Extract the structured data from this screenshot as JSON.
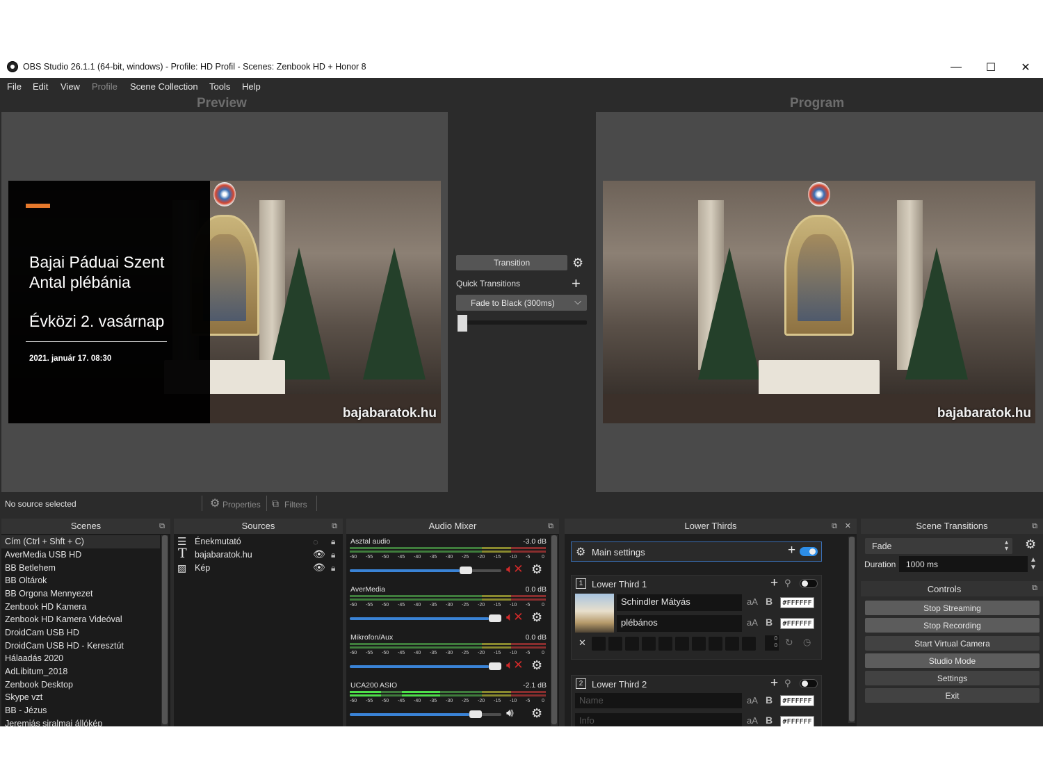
{
  "window": {
    "title": "OBS Studio 26.1.1 (64-bit, windows) - Profile: HD Profil - Scenes: Zenbook HD + Honor 8",
    "minimize": "—",
    "maximize": "☐",
    "close": "✕"
  },
  "menu": {
    "items": [
      "File",
      "Edit",
      "View",
      "Profile",
      "Scene Collection",
      "Tools",
      "Help"
    ],
    "disabled": [
      "Profile"
    ]
  },
  "preview": {
    "label": "Preview",
    "title_line1": "Bajai Páduai Szent",
    "title_line2": "Antal plébánia",
    "title_line3": "Évközi 2. vasárnap",
    "datetime": "2021. január 17. 08:30",
    "watermark": "bajabaratok.hu"
  },
  "program": {
    "label": "Program",
    "watermark": "bajabaratok.hu"
  },
  "transition_panel": {
    "transition_button": "Transition",
    "quick_transitions_label": "Quick Transitions",
    "selected_quick_transition": "Fade to Black (300ms)",
    "tbar_position": 0
  },
  "status": {
    "no_source": "No source selected",
    "properties": "Properties",
    "filters": "Filters"
  },
  "scenes": {
    "title": "Scenes",
    "items": [
      "Cím (Ctrl + Shft + C)",
      "AverMedia USB HD",
      "BB Betlehem",
      "BB Oltárok",
      "BB Orgona Mennyezet",
      "Zenbook HD Kamera",
      "Zenbook HD Kamera Videóval",
      "DroidCam USB HD",
      "DroidCam USB HD - Keresztút",
      "Hálaadás 2020",
      "AdLibitum_2018",
      "Zenbook Desktop",
      "Skype vzt",
      "BB - Jézus",
      "Jeremiás siralmai állókép"
    ]
  },
  "sources": {
    "title": "Sources",
    "items": [
      {
        "name": "Énekmutató",
        "icon": "list-icon",
        "visible": false
      },
      {
        "name": "bajabaratok.hu",
        "icon": "text-icon",
        "visible": true
      },
      {
        "name": "Kép",
        "icon": "image-icon",
        "visible": true
      }
    ]
  },
  "audio_mixer": {
    "title": "Audio Mixer",
    "tick_labels": [
      "-60",
      "-55",
      "-50",
      "-45",
      "-40",
      "-35",
      "-30",
      "-25",
      "-20",
      "-15",
      "-10",
      "-5",
      "0"
    ],
    "channels": [
      {
        "name": "Asztal audio",
        "db": "-3.0 dB",
        "volume": 0.79,
        "muted": true
      },
      {
        "name": "AverMedia",
        "db": "0.0 dB",
        "volume": 1.0,
        "muted": true
      },
      {
        "name": "Mikrofon/Aux",
        "db": "0.0 dB",
        "volume": 1.0,
        "muted": true
      },
      {
        "name": "UCA200 ASIO",
        "db": "-2.1 dB",
        "volume": 0.86,
        "muted": false
      }
    ]
  },
  "lower_thirds": {
    "title": "Lower Thirds",
    "main_settings": "Main settings",
    "card1": {
      "label": "Lower Third 1",
      "name_value": "Schindler Mátyás",
      "info_value": "plébános",
      "name_color": "#FFFFFF",
      "info_color": "#FFFFFF",
      "font_size_glyph": "aA",
      "bold_glyph": "B"
    },
    "card2": {
      "label": "Lower Third 2",
      "name_placeholder": "Name",
      "info_placeholder": "Info",
      "name_color": "#FFFFFF",
      "info_color": "#FFFFFF",
      "font_size_glyph": "aA",
      "bold_glyph": "B"
    },
    "counter_up": "0",
    "counter_down": "0"
  },
  "scene_transitions": {
    "title": "Scene Transitions",
    "selected": "Fade",
    "duration_label": "Duration",
    "duration_value": "1000 ms"
  },
  "controls": {
    "title": "Controls",
    "buttons": [
      "Stop Streaming",
      "Stop Recording",
      "Start Virtual Camera",
      "Studio Mode",
      "Settings",
      "Exit"
    ]
  },
  "colors": {
    "accent_blue": "#3a83d6",
    "mute_red": "#d42a2a",
    "title_bar_accent": "#e6792c"
  }
}
